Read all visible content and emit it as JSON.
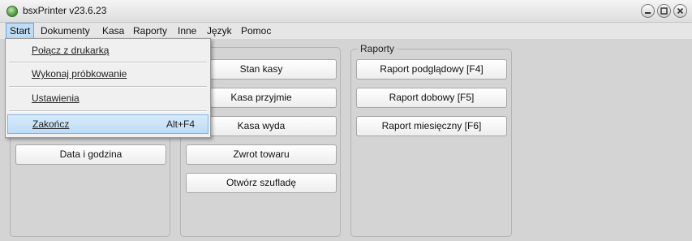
{
  "window": {
    "title": "bsxPrinter v23.6.23"
  },
  "menubar": {
    "items": [
      "Start",
      "Dokumenty",
      "Kasa",
      "Raporty",
      "Inne",
      "Język",
      "Pomoc"
    ]
  },
  "dropdown": {
    "items": [
      {
        "label": "Połącz z drukarką"
      },
      {
        "label": "Wykonaj próbkowanie"
      },
      {
        "label": "Ustawienia"
      },
      {
        "label": "Zakończ",
        "shortcut": "Alt+F4"
      }
    ]
  },
  "left_group": {
    "buttons": [
      "Data i godzina"
    ]
  },
  "middle_group": {
    "buttons": [
      "Stan kasy",
      "Kasa przyjmie",
      "Kasa wyda",
      "Zwrot towaru",
      "Otwórz szufladę"
    ]
  },
  "reports_group": {
    "title": "Raporty",
    "buttons": [
      "Raport podglądowy [F4]",
      "Raport dobowy [F5]",
      "Raport miesięczny [F6]"
    ]
  },
  "icons": [
    "app-icon",
    "minimize-icon",
    "maximize-icon",
    "close-icon"
  ],
  "colors": {
    "menu_highlight": "#bfdcf5",
    "item_highlight": "#bcdcf6",
    "background": "#d4d4d4"
  }
}
